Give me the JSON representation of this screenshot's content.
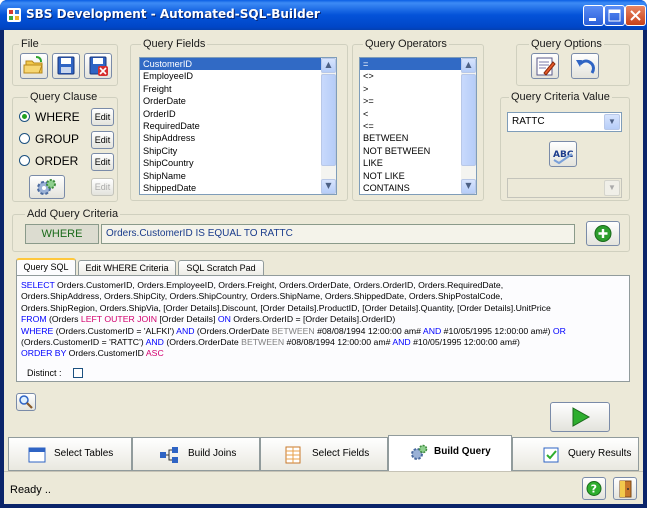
{
  "window": {
    "title": "SBS Development - Automated-SQL-Builder"
  },
  "file_group": {
    "legend": "File"
  },
  "query_clause": {
    "legend": "Query Clause",
    "options": [
      {
        "label": "WHERE",
        "selected": true,
        "edit_label": "Edit",
        "edit_enabled": true
      },
      {
        "label": "GROUP",
        "selected": false,
        "edit_label": "Edit",
        "edit_enabled": true
      },
      {
        "label": "ORDER",
        "selected": false,
        "edit_label": "Edit",
        "edit_enabled": true
      }
    ],
    "extra_edit_label": "Edit"
  },
  "query_fields": {
    "legend": "Query Fields",
    "items": [
      "CustomerID",
      "EmployeeID",
      "Freight",
      "OrderDate",
      "OrderID",
      "RequiredDate",
      "ShipAddress",
      "ShipCity",
      "ShipCountry",
      "ShipName",
      "ShippedDate"
    ],
    "selected": "CustomerID"
  },
  "query_operators": {
    "legend": "Query Operators",
    "items": [
      "=",
      "<>",
      ">",
      ">=",
      "<",
      "<=",
      "BETWEEN",
      "NOT BETWEEN",
      "LIKE",
      "NOT LIKE",
      "CONTAINS"
    ],
    "selected": "="
  },
  "query_options": {
    "legend": "Query Options"
  },
  "query_criteria_value": {
    "legend": "Query Criteria Value",
    "value": "RATTC",
    "second_value": ""
  },
  "add_query_criteria": {
    "legend": "Add Query Criteria",
    "clause_label": "WHERE",
    "criteria_text": "Orders.CustomerID IS EQUAL TO RATTC"
  },
  "tabs": [
    {
      "label": "Query SQL",
      "active": true
    },
    {
      "label": "Edit WHERE Criteria",
      "active": false
    },
    {
      "label": "SQL Scratch Pad",
      "active": false
    }
  ],
  "sql": {
    "l1_kw": "SELECT",
    "l1": " Orders.CustomerID, Orders.EmployeeID, Orders.Freight, Orders.OrderDate, Orders.OrderID, Orders.RequiredDate,",
    "l2": "Orders.ShipAddress, Orders.ShipCity, Orders.ShipCountry, Orders.ShipName, Orders.ShippedDate, Orders.ShipPostalCode,",
    "l3": "Orders.ShipRegion, Orders.ShipVia, [Order Details].Discount, [Order Details].ProductID, [Order Details].Quantity, [Order Details].UnitPrice",
    "l4_kw1": "FROM",
    "l4_a": " (Orders ",
    "l4_kw2": "LEFT OUTER JOIN",
    "l4_b": " [Order Details] ",
    "l4_kw3": "ON",
    "l4_c": " Orders.OrderID = [Order Details].OrderID)",
    "l5_kw1": "WHERE",
    "l5_a": " (Orders.CustomerID = 'ALFKI') ",
    "l5_kw2": "AND",
    "l5_b": " (Orders.OrderDate ",
    "l5_kw3": "BETWEEN",
    "l5_c": " #08/08/1994 12:00:00 am# ",
    "l5_kw4": "AND",
    "l5_d": " #10/05/1995 12:00:00 am#) ",
    "l5_kw5": "OR",
    "l6_a": "(Orders.CustomerID = 'RATTC') ",
    "l6_kw1": "AND",
    "l6_b": " (Orders.OrderDate ",
    "l6_kw2": "BETWEEN",
    "l6_c": " #08/08/1994 12:00:00 am# ",
    "l6_kw3": "AND",
    "l6_d": " #10/05/1995 12:00:00 am#)",
    "l7_kw1": "ORDER BY",
    "l7_a": " Orders.CustomerID ",
    "l7_kw2": "ASC"
  },
  "distinct_label": "Distinct :",
  "bottom_tabs": [
    {
      "label": "Select Tables",
      "active": false
    },
    {
      "label": "Build Joins",
      "active": false
    },
    {
      "label": "Select Fields",
      "active": false
    },
    {
      "label": "Build Query",
      "active": true
    },
    {
      "label": "Query Results",
      "active": false
    }
  ],
  "status": {
    "text": "Ready .."
  },
  "colors": {
    "title_bar": "#0453d9",
    "selection": "#316ac5",
    "sql_keyword": "#0000ff",
    "sql_order_keyword": "#d2006e",
    "criteria_text": "#1a3c8c"
  }
}
